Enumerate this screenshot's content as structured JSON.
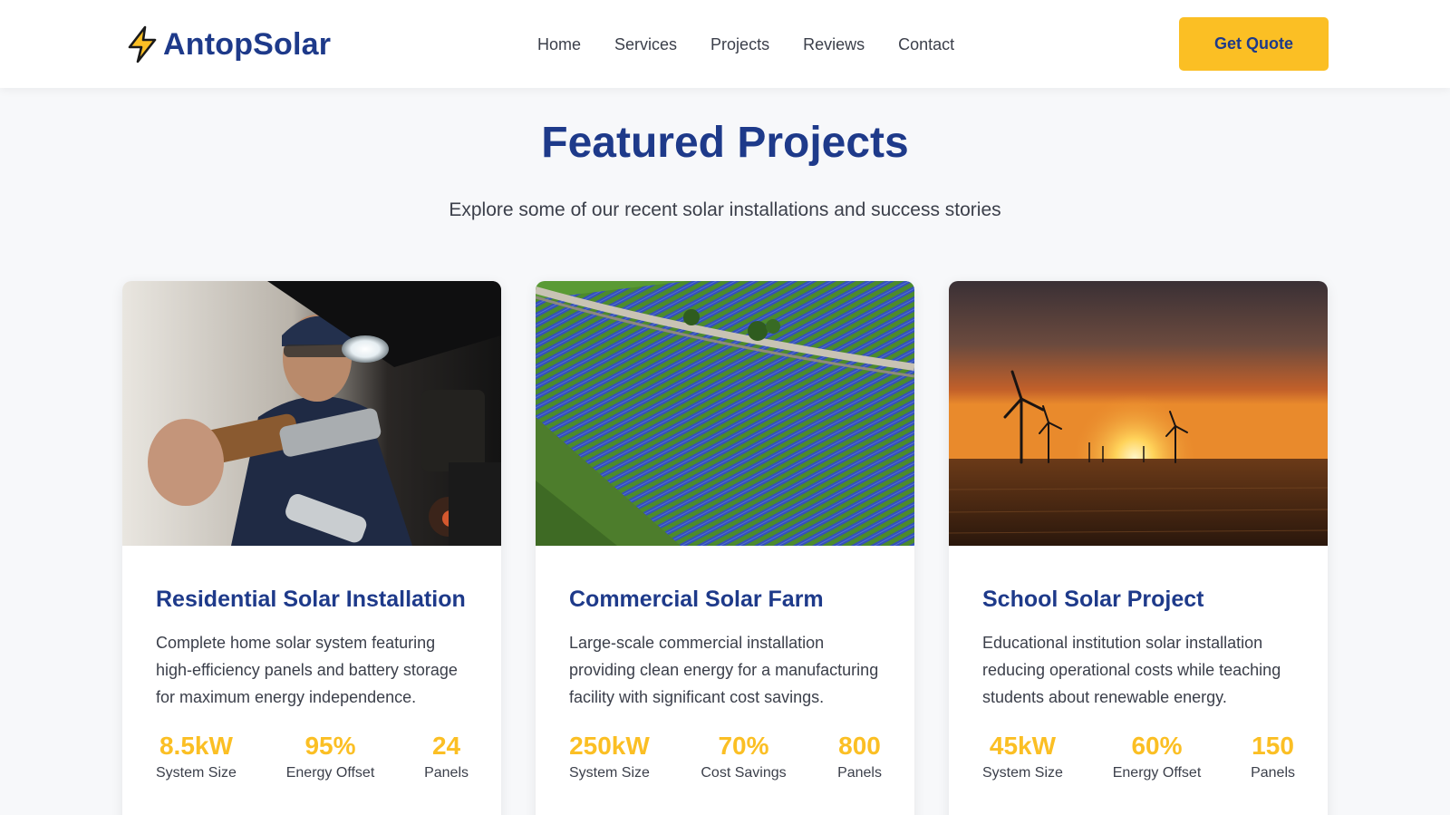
{
  "header": {
    "logo_text": "AntopSolar",
    "nav": [
      "Home",
      "Services",
      "Projects",
      "Reviews",
      "Contact"
    ],
    "cta_label": "Get Quote"
  },
  "section": {
    "title": "Featured Projects",
    "subtitle": "Explore some of our recent solar installations and success stories"
  },
  "projects": [
    {
      "title": "Residential Solar Installation",
      "description": "Complete home solar system featuring high-efficiency panels and battery storage for maximum energy independence.",
      "stats": [
        {
          "value": "8.5kW",
          "label": "System Size"
        },
        {
          "value": "95%",
          "label": "Energy Offset"
        },
        {
          "value": "24",
          "label": "Panels"
        }
      ]
    },
    {
      "title": "Commercial Solar Farm",
      "description": "Large-scale commercial installation providing clean energy for a manufacturing facility with significant cost savings.",
      "stats": [
        {
          "value": "250kW",
          "label": "System Size"
        },
        {
          "value": "70%",
          "label": "Cost Savings"
        },
        {
          "value": "800",
          "label": "Panels"
        }
      ]
    },
    {
      "title": "School Solar Project",
      "description": "Educational institution solar installation reducing operational costs while teaching students about renewable energy.",
      "stats": [
        {
          "value": "45kW",
          "label": "System Size"
        },
        {
          "value": "60%",
          "label": "Energy Offset"
        },
        {
          "value": "150",
          "label": "Panels"
        }
      ]
    }
  ],
  "colors": {
    "brand": "#1e3a8a",
    "accent": "#fbbf24",
    "text": "#3b3f4a"
  },
  "icons": {
    "logo": "lightning-bolt-icon"
  }
}
